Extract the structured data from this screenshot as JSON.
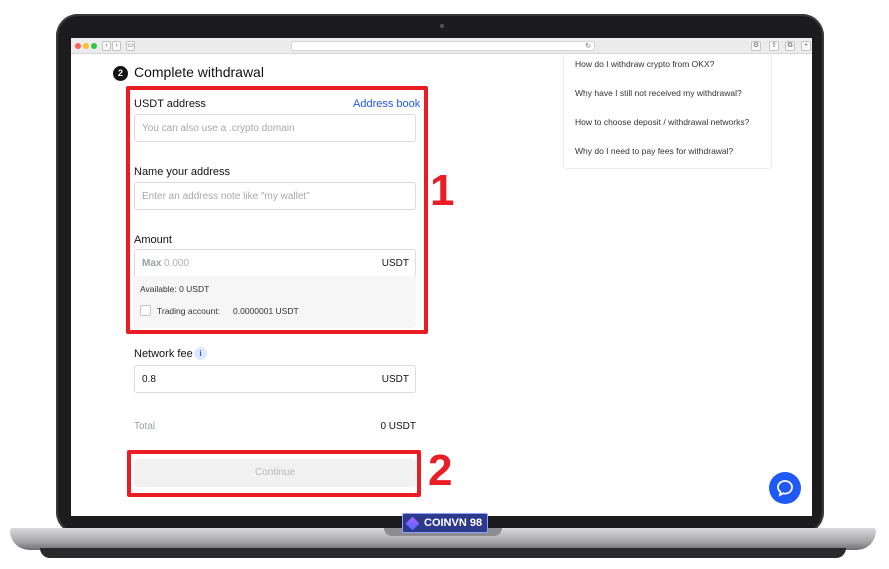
{
  "browser": {
    "back_icon": "chevron-left-icon",
    "forward_icon": "chevron-right-icon",
    "reload_icon": "reload-icon"
  },
  "step": {
    "number": "2",
    "title": "Complete withdrawal"
  },
  "form": {
    "address_label": "USDT address",
    "address_book_link": "Address book",
    "address_placeholder": "You can also use a .crypto domain",
    "name_label": "Name your address",
    "name_placeholder": "Enter an address note like \"my wallet\"",
    "amount_label": "Amount",
    "amount_max": "Max",
    "amount_placeholder": "0.000",
    "amount_unit": "USDT",
    "available_text": "Available:  0 USDT",
    "trading_account_label": "Trading account:",
    "trading_account_value": "0.0000001 USDT",
    "fee_label": "Network fee",
    "fee_info_icon": "i",
    "fee_value": "0.8",
    "fee_unit": "USDT",
    "total_label": "Total",
    "total_value": "0 USDT",
    "continue_label": "Continue"
  },
  "faq": {
    "items": [
      "How do I withdraw crypto from OKX?",
      "Why have I still not received my withdrawal?",
      "How to choose deposit / withdrawal networks?",
      "Why do I need to pay fees for withdrawal?"
    ]
  },
  "annotations": {
    "box1_number": "1",
    "box2_number": "2"
  },
  "watermark": {
    "text": "COINVN 98"
  },
  "colors": {
    "accent_blue": "#1f5af6",
    "annotation_red": "#ea1c24",
    "text_primary": "#121212"
  },
  "icons": {
    "chat": "chat-bubble-icon",
    "info": "info-icon"
  }
}
